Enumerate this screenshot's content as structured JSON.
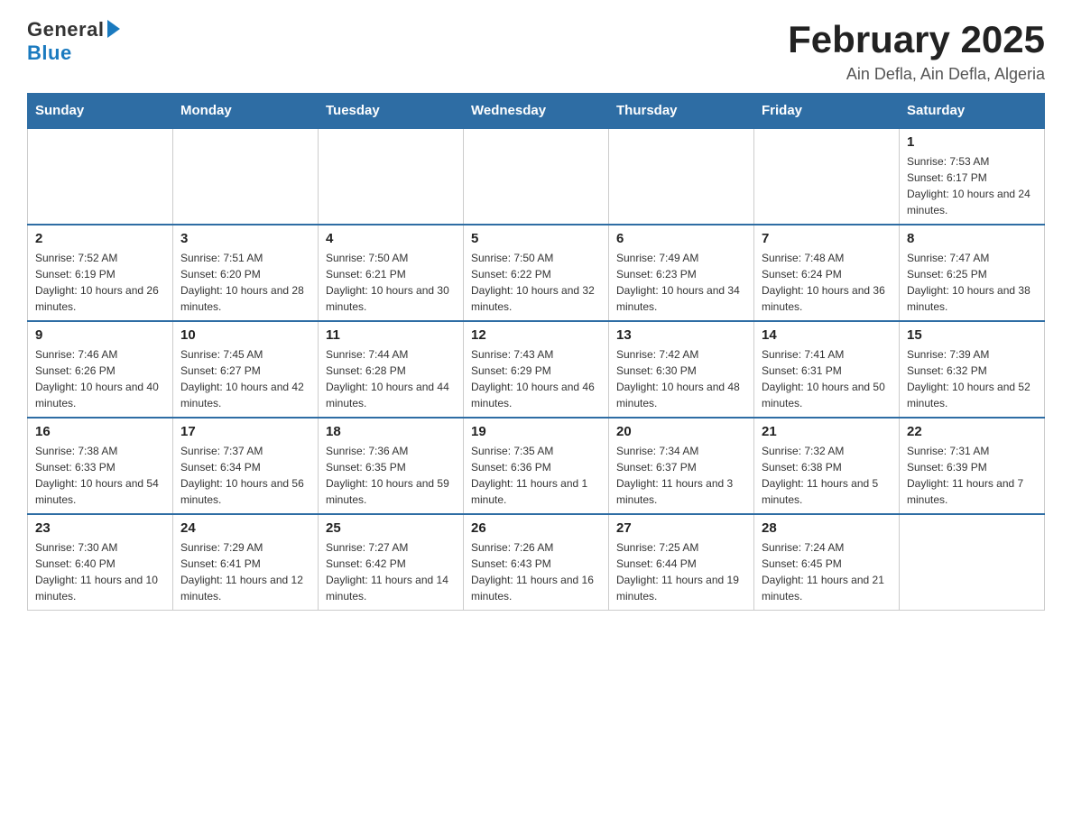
{
  "logo": {
    "general": "General",
    "blue": "Blue"
  },
  "title": "February 2025",
  "location": "Ain Defla, Ain Defla, Algeria",
  "days_of_week": [
    "Sunday",
    "Monday",
    "Tuesday",
    "Wednesday",
    "Thursday",
    "Friday",
    "Saturday"
  ],
  "weeks": [
    [
      {
        "day": "",
        "info": ""
      },
      {
        "day": "",
        "info": ""
      },
      {
        "day": "",
        "info": ""
      },
      {
        "day": "",
        "info": ""
      },
      {
        "day": "",
        "info": ""
      },
      {
        "day": "",
        "info": ""
      },
      {
        "day": "1",
        "info": "Sunrise: 7:53 AM\nSunset: 6:17 PM\nDaylight: 10 hours and 24 minutes."
      }
    ],
    [
      {
        "day": "2",
        "info": "Sunrise: 7:52 AM\nSunset: 6:19 PM\nDaylight: 10 hours and 26 minutes."
      },
      {
        "day": "3",
        "info": "Sunrise: 7:51 AM\nSunset: 6:20 PM\nDaylight: 10 hours and 28 minutes."
      },
      {
        "day": "4",
        "info": "Sunrise: 7:50 AM\nSunset: 6:21 PM\nDaylight: 10 hours and 30 minutes."
      },
      {
        "day": "5",
        "info": "Sunrise: 7:50 AM\nSunset: 6:22 PM\nDaylight: 10 hours and 32 minutes."
      },
      {
        "day": "6",
        "info": "Sunrise: 7:49 AM\nSunset: 6:23 PM\nDaylight: 10 hours and 34 minutes."
      },
      {
        "day": "7",
        "info": "Sunrise: 7:48 AM\nSunset: 6:24 PM\nDaylight: 10 hours and 36 minutes."
      },
      {
        "day": "8",
        "info": "Sunrise: 7:47 AM\nSunset: 6:25 PM\nDaylight: 10 hours and 38 minutes."
      }
    ],
    [
      {
        "day": "9",
        "info": "Sunrise: 7:46 AM\nSunset: 6:26 PM\nDaylight: 10 hours and 40 minutes."
      },
      {
        "day": "10",
        "info": "Sunrise: 7:45 AM\nSunset: 6:27 PM\nDaylight: 10 hours and 42 minutes."
      },
      {
        "day": "11",
        "info": "Sunrise: 7:44 AM\nSunset: 6:28 PM\nDaylight: 10 hours and 44 minutes."
      },
      {
        "day": "12",
        "info": "Sunrise: 7:43 AM\nSunset: 6:29 PM\nDaylight: 10 hours and 46 minutes."
      },
      {
        "day": "13",
        "info": "Sunrise: 7:42 AM\nSunset: 6:30 PM\nDaylight: 10 hours and 48 minutes."
      },
      {
        "day": "14",
        "info": "Sunrise: 7:41 AM\nSunset: 6:31 PM\nDaylight: 10 hours and 50 minutes."
      },
      {
        "day": "15",
        "info": "Sunrise: 7:39 AM\nSunset: 6:32 PM\nDaylight: 10 hours and 52 minutes."
      }
    ],
    [
      {
        "day": "16",
        "info": "Sunrise: 7:38 AM\nSunset: 6:33 PM\nDaylight: 10 hours and 54 minutes."
      },
      {
        "day": "17",
        "info": "Sunrise: 7:37 AM\nSunset: 6:34 PM\nDaylight: 10 hours and 56 minutes."
      },
      {
        "day": "18",
        "info": "Sunrise: 7:36 AM\nSunset: 6:35 PM\nDaylight: 10 hours and 59 minutes."
      },
      {
        "day": "19",
        "info": "Sunrise: 7:35 AM\nSunset: 6:36 PM\nDaylight: 11 hours and 1 minute."
      },
      {
        "day": "20",
        "info": "Sunrise: 7:34 AM\nSunset: 6:37 PM\nDaylight: 11 hours and 3 minutes."
      },
      {
        "day": "21",
        "info": "Sunrise: 7:32 AM\nSunset: 6:38 PM\nDaylight: 11 hours and 5 minutes."
      },
      {
        "day": "22",
        "info": "Sunrise: 7:31 AM\nSunset: 6:39 PM\nDaylight: 11 hours and 7 minutes."
      }
    ],
    [
      {
        "day": "23",
        "info": "Sunrise: 7:30 AM\nSunset: 6:40 PM\nDaylight: 11 hours and 10 minutes."
      },
      {
        "day": "24",
        "info": "Sunrise: 7:29 AM\nSunset: 6:41 PM\nDaylight: 11 hours and 12 minutes."
      },
      {
        "day": "25",
        "info": "Sunrise: 7:27 AM\nSunset: 6:42 PM\nDaylight: 11 hours and 14 minutes."
      },
      {
        "day": "26",
        "info": "Sunrise: 7:26 AM\nSunset: 6:43 PM\nDaylight: 11 hours and 16 minutes."
      },
      {
        "day": "27",
        "info": "Sunrise: 7:25 AM\nSunset: 6:44 PM\nDaylight: 11 hours and 19 minutes."
      },
      {
        "day": "28",
        "info": "Sunrise: 7:24 AM\nSunset: 6:45 PM\nDaylight: 11 hours and 21 minutes."
      },
      {
        "day": "",
        "info": ""
      }
    ]
  ]
}
